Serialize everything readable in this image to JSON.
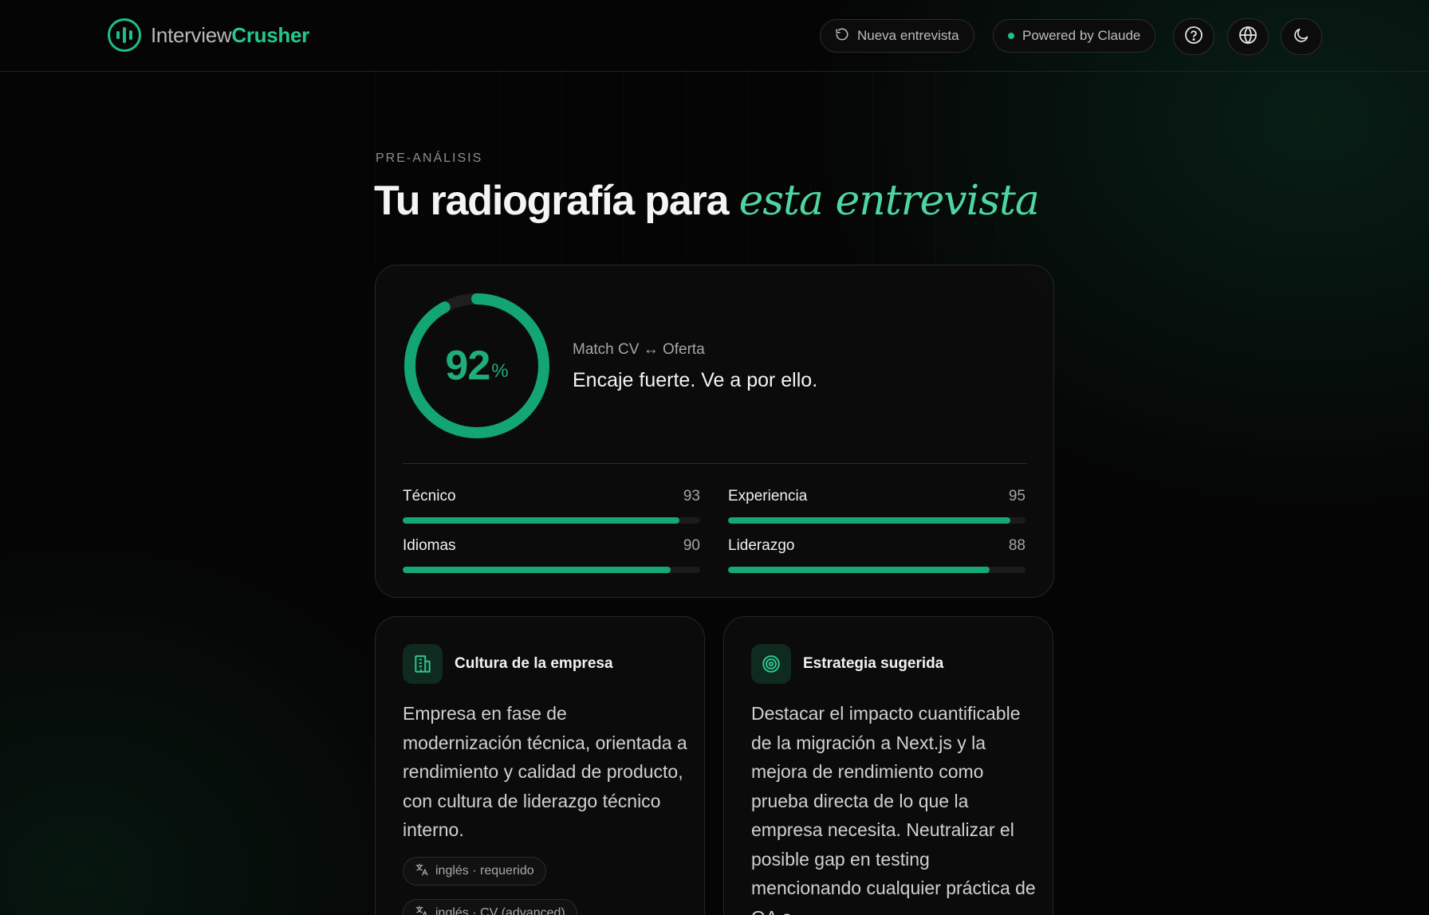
{
  "header": {
    "logo_part1": "Interview",
    "logo_part2": "Crusher",
    "new_interview_label": "Nueva entrevista",
    "powered_by_label": "Powered by Claude"
  },
  "page": {
    "eyebrow": "PRE-ANÁLISIS",
    "title_main": "Tu radiografía para ",
    "title_accent": "esta entrevista"
  },
  "score": {
    "value": "92",
    "unit": "%",
    "fraction": 0.92,
    "label": "Match CV ↔ Oferta",
    "verdict": "Encaje fuerte. Ve a por ello."
  },
  "metrics": [
    {
      "name": "Técnico",
      "value": "93"
    },
    {
      "name": "Experiencia",
      "value": "95"
    },
    {
      "name": "Idiomas",
      "value": "90"
    },
    {
      "name": "Liderazgo",
      "value": "88"
    }
  ],
  "culture": {
    "title": "Cultura de la empresa",
    "body": "Empresa en fase de modernización técnica, orientada a rendimiento y calidad de producto, con cultura de liderazgo técnico interno.",
    "tags": [
      "inglés · requerido",
      "inglés · CV (advanced)"
    ]
  },
  "strategy": {
    "title": "Estrategia sugerida",
    "body": "Destacar el impacto cuantificable de la migración a Next.js y la mejora de rendimiento como prueba directa de lo que la empresa necesita. Neutralizar el posible gap en testing mencionando cualquier práctica de QA o"
  },
  "colors": {
    "accent": "#1fbf85",
    "accent_text": "#4fd6a0",
    "bar_fill": "#14a874",
    "background": "#050505"
  },
  "icons": {
    "logo": "audio-bars-icon",
    "new_interview": "refresh-icon",
    "help": "help-circle-icon",
    "language": "globe-icon",
    "theme": "moon-icon",
    "culture": "building-icon",
    "strategy": "target-icon",
    "tag": "translate-icon"
  }
}
